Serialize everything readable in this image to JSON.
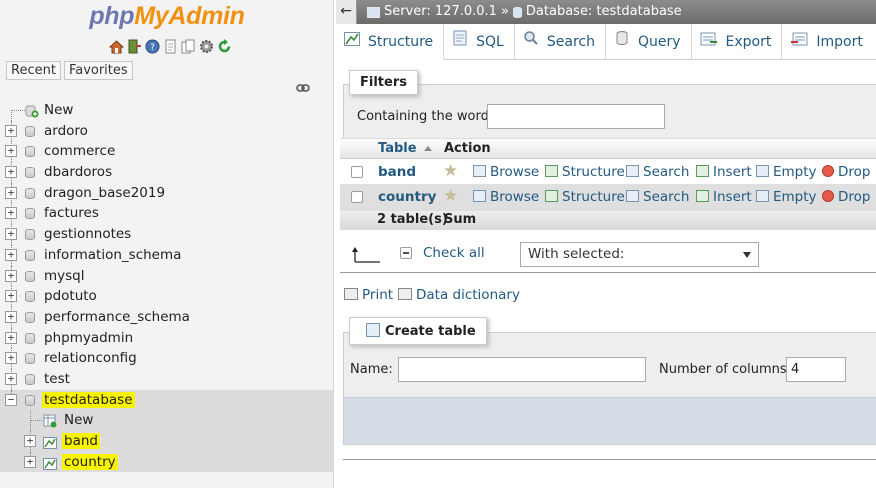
{
  "logo": {
    "php": "php",
    "myadmin": "MyAdmin"
  },
  "nav_icons": [
    "home-icon",
    "logout-icon",
    "help-icon",
    "docs-icon",
    "copy-icon",
    "settings-icon",
    "reload-icon"
  ],
  "nav_tabs": {
    "recent": "Recent",
    "favorites": "Favorites"
  },
  "tree": {
    "new_label": "New",
    "databases": [
      "ardoro",
      "commerce",
      "dbardoros",
      "dragon_base2019",
      "factures",
      "gestionnotes",
      "information_schema",
      "mysql",
      "pdotuto",
      "performance_schema",
      "phpmyadmin",
      "relationconfig",
      "test"
    ],
    "selected_db": "testdatabase",
    "sub_new_label": "New",
    "tables": [
      "band",
      "country"
    ]
  },
  "breadcrumb": {
    "server": "Server: 127.0.0.1",
    "separator": "»",
    "database": "Database: testdatabase"
  },
  "tabs": [
    {
      "label": "Structure",
      "icon": "structure-icon"
    },
    {
      "label": "SQL",
      "icon": "sql-icon"
    },
    {
      "label": "Search",
      "icon": "search-icon"
    },
    {
      "label": "Query",
      "icon": "query-icon"
    },
    {
      "label": "Export",
      "icon": "export-icon"
    },
    {
      "label": "Import",
      "icon": "import-icon"
    }
  ],
  "filters": {
    "legend": "Filters",
    "label": "Containing the word:",
    "value": ""
  },
  "table": {
    "col_table": "Table",
    "col_action": "Action",
    "actions": {
      "browse": "Browse",
      "structure": "Structure",
      "search": "Search",
      "insert": "Insert",
      "empty": "Empty",
      "drop": "Drop"
    },
    "rows": [
      {
        "name": "band"
      },
      {
        "name": "country"
      }
    ],
    "summary_count": "2 table(s)",
    "summary_sum": "Sum"
  },
  "check_all": "Check all",
  "with_selected": "With selected:",
  "print": "Print",
  "data_dictionary": "Data dictionary",
  "create_table": {
    "legend": "Create table",
    "name_label": "Name:",
    "name_value": "",
    "columns_label": "Number of columns:",
    "columns_value": "4"
  },
  "colors": {
    "link": "#235a81",
    "highlight": "#f8f400",
    "logo_php": "#6c78af",
    "logo_myadmin": "#f29111"
  }
}
